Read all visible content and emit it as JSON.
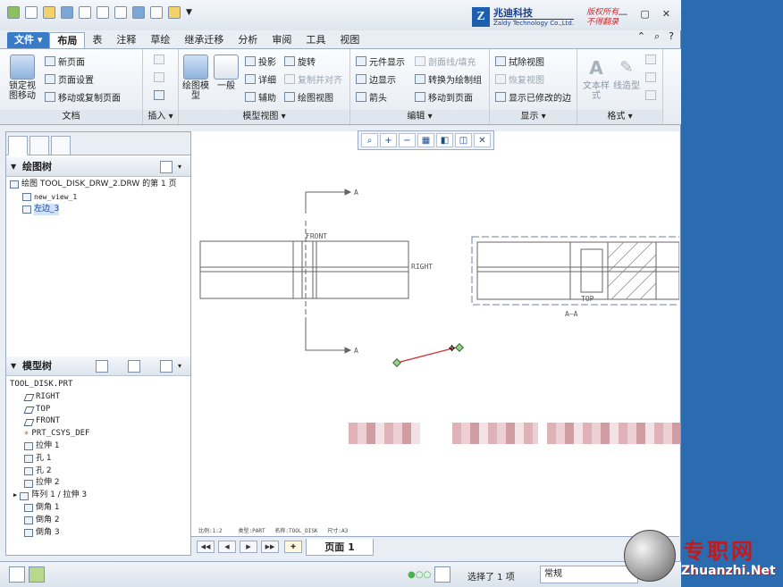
{
  "tabs": {
    "file": "文件",
    "items": [
      "布局",
      "表",
      "注释",
      "草绘",
      "继承迁移",
      "分析",
      "审阅",
      "工具",
      "视图"
    ]
  },
  "logo": {
    "mark": "Z",
    "cn": "兆迪科技",
    "en": "Zaldy Technology Co.,Ltd.",
    "slogan1": "版权所有",
    "slogan2": "不得翻录"
  },
  "ribbon": {
    "doc": {
      "label": "文档",
      "lock": "锁定视图移动",
      "new_page": "新页面",
      "page_setup": "页面设置",
      "move_copy": "移动或复制页面"
    },
    "insert": {
      "label": "插入"
    },
    "model": {
      "label": "模型视图",
      "drawing_model": "绘图模型",
      "general": "一般",
      "projection": "投影",
      "detail": "详细",
      "auxiliary": "辅助",
      "revolve": "旋转",
      "copy_align": "复制并对齐",
      "drawing_view": "绘图视图"
    },
    "edit": {
      "label": "编辑",
      "element_display": "元件显示",
      "edge_display": "边显示",
      "arrow": "箭头",
      "section_fill": "剖面线/填充",
      "convert": "转换为绘制组",
      "move_page": "移动到页面"
    },
    "display": {
      "label": "显示",
      "erase_view": "拭除视图",
      "restore_view": "恢复视图",
      "show_modified": "显示已修改的边"
    },
    "format": {
      "label": "格式",
      "text_style": "文本样式",
      "line_style": "线造型"
    }
  },
  "drawing_tree": {
    "title": "绘图树",
    "items": [
      "绘图 TOOL_DISK_DRW_2.DRW 的第 1 页",
      "new_view_1",
      "左边_3"
    ]
  },
  "model_tree": {
    "title": "模型树",
    "items": [
      "TOOL_DISK.PRT",
      "RIGHT",
      "TOP",
      "FRONT",
      "PRT_CSYS_DEF",
      "拉伸 1",
      "孔 1",
      "孔 2",
      "拉伸 2",
      "阵列 1 / 拉伸 3",
      "倒角 1",
      "倒角 2",
      "倒角 3"
    ]
  },
  "canvas": {
    "front": "FRONT",
    "right": "RIGHT",
    "top": "TOP",
    "section": "A–A",
    "arrow_a": "A"
  },
  "sheet": {
    "page": "页面 1"
  },
  "statline": {
    "scale": "比例:1:2",
    "type": "类型:PART",
    "name": "名称:TOOL_DISK",
    "size": "尺寸:A3"
  },
  "status": {
    "selected": "选择了 1 项",
    "filter": "常规"
  },
  "watermark": {
    "cn": "专职网",
    "en": "Zhuanzhi.Net"
  }
}
